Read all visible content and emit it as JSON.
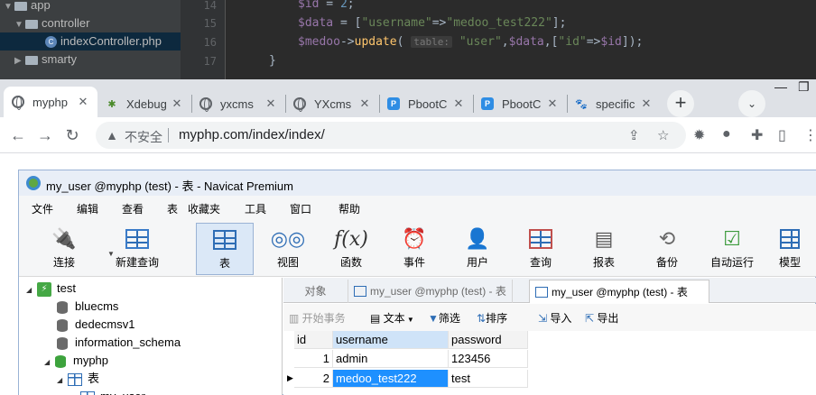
{
  "ide": {
    "tree": [
      {
        "label": "app",
        "expanded": true
      },
      {
        "label": "controller",
        "expanded": true
      },
      {
        "label": "indexController.php"
      },
      {
        "label": "smarty",
        "expanded": false
      }
    ],
    "line_numbers": [
      "14",
      "15",
      "16",
      "17"
    ],
    "code": {
      "l14_var": "$id",
      "l14_rest": " = ",
      "l14_num": "2",
      "l14_end": ";",
      "l15_var": "$data",
      "l15_eq": " = [",
      "l15_key": "\"username\"",
      "l15_arrow": "=>",
      "l15_val": "\"medoo_test222\"",
      "l15_end": "];",
      "l16_var": "$medoo",
      "l16_arrow": "->",
      "l16_fn": "update",
      "l16_paren": "( ",
      "l16_hint": "table:",
      "l16_table": " \"user\"",
      "l16_comma": ",",
      "l16_var2": "$data",
      "l16_br": ",[",
      "l16_key": "\"id\"",
      "l16_arr2": "=>",
      "l16_var3": "$id",
      "l16_end": "]);",
      "l17": "}"
    }
  },
  "browser": {
    "tabs": [
      {
        "title": "myphp",
        "icon": "globe-icon",
        "active": true
      },
      {
        "title": "Xdebug",
        "icon": "bug-icon"
      },
      {
        "title": "yxcms",
        "icon": "globe-icon"
      },
      {
        "title": "YXcms",
        "icon": "globe-icon"
      },
      {
        "title": "PbootC",
        "icon": "pbootcms-icon"
      },
      {
        "title": "PbootC",
        "icon": "pbootcms-icon"
      },
      {
        "title": "specific",
        "icon": "baidu-paw-icon"
      }
    ],
    "tab_close": "✕",
    "new_tab": "+",
    "address": {
      "security_label": "不安全",
      "url": "myphp.com/index/index/"
    }
  },
  "navicat": {
    "title": "my_user @myphp (test) - 表 - Navicat Premium",
    "menu": [
      "文件",
      "编辑",
      "查看",
      "表",
      "收藏夹",
      "工具",
      "窗口",
      "帮助"
    ],
    "tools": [
      {
        "label": "连接",
        "icon": "plug-icon"
      },
      {
        "label": "新建查询",
        "icon": "new-query-icon"
      },
      {
        "label": "表",
        "icon": "table-icon",
        "active": true
      },
      {
        "label": "视图",
        "icon": "view-icon"
      },
      {
        "label": "函数",
        "icon": "function-icon"
      },
      {
        "label": "事件",
        "icon": "clock-icon"
      },
      {
        "label": "用户",
        "icon": "user-icon"
      },
      {
        "label": "查询",
        "icon": "query-icon"
      },
      {
        "label": "报表",
        "icon": "report-icon"
      },
      {
        "label": "备份",
        "icon": "backup-icon"
      },
      {
        "label": "自动运行",
        "icon": "autorun-icon"
      },
      {
        "label": "模型",
        "icon": "model-icon"
      }
    ],
    "tree": {
      "connection": "test",
      "databases": [
        "bluecms",
        "dedecmsv1",
        "information_schema",
        "myphp"
      ],
      "table_group": "表",
      "table_item": "my_user"
    },
    "tabs": {
      "objects": "对象",
      "tab1": "my_user @myphp (test) - 表",
      "tab2": "my_user @myphp (test) - 表"
    },
    "subtoolbar": {
      "begin_tx": "开始事务",
      "text": "文本",
      "filter": "筛选",
      "sort": "排序",
      "import": "导入",
      "export": "导出"
    },
    "grid": {
      "columns": [
        "id",
        "username",
        "password"
      ],
      "rows": [
        {
          "id": "1",
          "username": "admin",
          "password": "123456"
        },
        {
          "id": "2",
          "username": "medoo_test222",
          "password": "test"
        }
      ]
    }
  }
}
